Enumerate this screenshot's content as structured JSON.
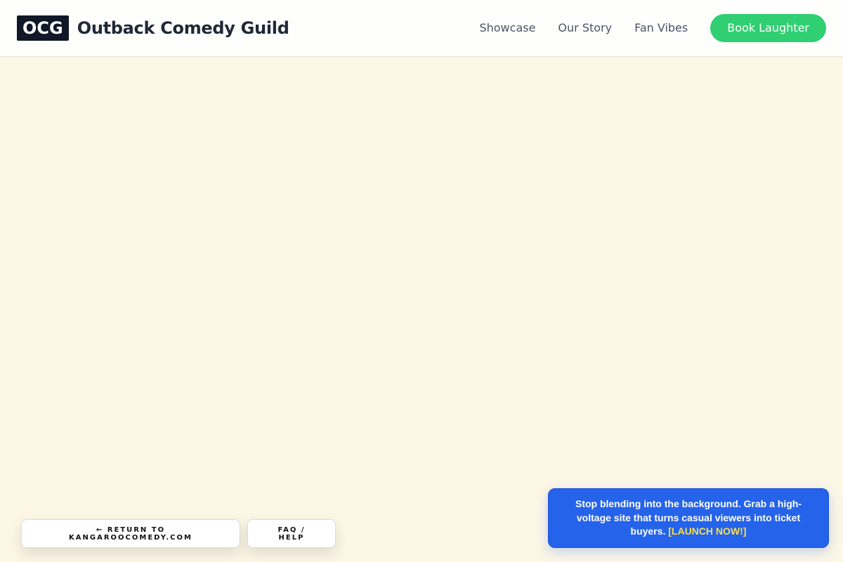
{
  "header": {
    "logo_text": "OCG",
    "brand_name": "Outback Comedy Guild",
    "nav": [
      {
        "label": "Showcase"
      },
      {
        "label": "Our Story"
      },
      {
        "label": "Fan Vibes"
      }
    ],
    "cta_label": "Book Laughter"
  },
  "footer_actions": {
    "return_label": "← RETURN TO KANGAROOCOMEDY.COM",
    "faq_label": "FAQ / HELP"
  },
  "promo": {
    "text": "Stop blending into the background. Grab a high-voltage site that turns casual viewers into ticket buyers.",
    "link_label": "[LAUNCH NOW!]"
  },
  "colors": {
    "background": "#fdf7e6",
    "cta": "#2fcf72",
    "promo": "#2563eb",
    "promo_link": "#fde047",
    "logo_badge": "#111827"
  }
}
